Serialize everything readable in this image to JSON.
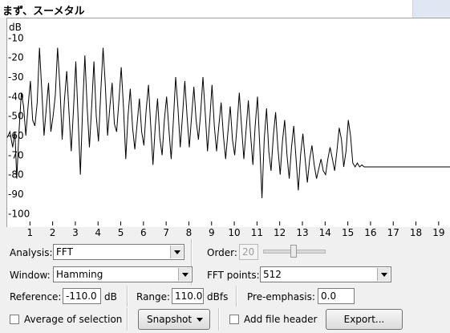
{
  "title": "まず、スーメタル",
  "chart_data": {
    "type": "line",
    "ylabel": "dB",
    "y_ticks": [
      "-10",
      "-20",
      "-30",
      "-40",
      "-50",
      "-60",
      "-70",
      "-80",
      "-90",
      "-100"
    ],
    "x_ticks": [
      "1",
      "2",
      "3",
      "4",
      "5",
      "6",
      "7",
      "8",
      "9",
      "10",
      "11",
      "12",
      "13",
      "14",
      "15",
      "16",
      "17",
      "18",
      "19"
    ],
    "xlim": [
      0,
      19.5
    ],
    "ylim": [
      -106,
      0
    ],
    "series": [
      {
        "points": [
          [
            0.0,
            -61
          ],
          [
            0.12,
            -58
          ],
          [
            0.24,
            -66
          ],
          [
            0.34,
            -58
          ],
          [
            0.42,
            -82
          ],
          [
            0.52,
            -58
          ],
          [
            0.62,
            -38
          ],
          [
            0.72,
            -45
          ],
          [
            0.82,
            -60
          ],
          [
            0.92,
            -45
          ],
          [
            1.02,
            -32
          ],
          [
            1.12,
            -52
          ],
          [
            1.22,
            -55
          ],
          [
            1.32,
            -43
          ],
          [
            1.42,
            -15
          ],
          [
            1.52,
            -36
          ],
          [
            1.62,
            -60
          ],
          [
            1.72,
            -46
          ],
          [
            1.82,
            -33
          ],
          [
            1.92,
            -58
          ],
          [
            2.02,
            -50
          ],
          [
            2.12,
            -39
          ],
          [
            2.22,
            -15
          ],
          [
            2.32,
            -35
          ],
          [
            2.42,
            -62
          ],
          [
            2.52,
            -42
          ],
          [
            2.62,
            -27
          ],
          [
            2.72,
            -48
          ],
          [
            2.82,
            -68
          ],
          [
            2.92,
            -46
          ],
          [
            3.02,
            -22
          ],
          [
            3.12,
            -50
          ],
          [
            3.22,
            -80
          ],
          [
            3.32,
            -46
          ],
          [
            3.42,
            -19
          ],
          [
            3.52,
            -45
          ],
          [
            3.62,
            -66
          ],
          [
            3.72,
            -45
          ],
          [
            3.82,
            -22
          ],
          [
            3.92,
            -50
          ],
          [
            4.02,
            -63
          ],
          [
            4.12,
            -38
          ],
          [
            4.22,
            -15
          ],
          [
            4.32,
            -34
          ],
          [
            4.42,
            -60
          ],
          [
            4.52,
            -45
          ],
          [
            4.62,
            -33
          ],
          [
            4.72,
            -54
          ],
          [
            4.82,
            -58
          ],
          [
            4.92,
            -42
          ],
          [
            5.02,
            -25
          ],
          [
            5.12,
            -45
          ],
          [
            5.22,
            -72
          ],
          [
            5.32,
            -50
          ],
          [
            5.42,
            -36
          ],
          [
            5.52,
            -56
          ],
          [
            5.62,
            -67
          ],
          [
            5.72,
            -54
          ],
          [
            5.82,
            -41
          ],
          [
            5.92,
            -58
          ],
          [
            6.02,
            -65
          ],
          [
            6.12,
            -47
          ],
          [
            6.22,
            -34
          ],
          [
            6.32,
            -55
          ],
          [
            6.42,
            -75
          ],
          [
            6.52,
            -55
          ],
          [
            6.62,
            -41
          ],
          [
            6.72,
            -61
          ],
          [
            6.82,
            -70
          ],
          [
            6.92,
            -52
          ],
          [
            7.02,
            -40
          ],
          [
            7.12,
            -57
          ],
          [
            7.22,
            -72
          ],
          [
            7.32,
            -52
          ],
          [
            7.42,
            -30
          ],
          [
            7.52,
            -46
          ],
          [
            7.62,
            -66
          ],
          [
            7.72,
            -50
          ],
          [
            7.82,
            -32
          ],
          [
            7.92,
            -50
          ],
          [
            8.02,
            -66
          ],
          [
            8.12,
            -50
          ],
          [
            8.22,
            -35
          ],
          [
            8.32,
            -52
          ],
          [
            8.42,
            -62
          ],
          [
            8.52,
            -48
          ],
          [
            8.62,
            -30
          ],
          [
            8.72,
            -48
          ],
          [
            8.82,
            -68
          ],
          [
            8.92,
            -52
          ],
          [
            9.02,
            -34
          ],
          [
            9.12,
            -55
          ],
          [
            9.22,
            -68
          ],
          [
            9.32,
            -55
          ],
          [
            9.42,
            -43
          ],
          [
            9.52,
            -60
          ],
          [
            9.62,
            -72
          ],
          [
            9.72,
            -58
          ],
          [
            9.82,
            -45
          ],
          [
            9.92,
            -62
          ],
          [
            10.02,
            -70
          ],
          [
            10.12,
            -55
          ],
          [
            10.22,
            -38
          ],
          [
            10.32,
            -55
          ],
          [
            10.42,
            -72
          ],
          [
            10.52,
            -57
          ],
          [
            10.62,
            -42
          ],
          [
            10.72,
            -60
          ],
          [
            10.82,
            -75
          ],
          [
            10.92,
            -55
          ],
          [
            11.02,
            -40
          ],
          [
            11.12,
            -65
          ],
          [
            11.22,
            -92
          ],
          [
            11.32,
            -62
          ],
          [
            11.42,
            -46
          ],
          [
            11.52,
            -68
          ],
          [
            11.62,
            -78
          ],
          [
            11.72,
            -60
          ],
          [
            11.82,
            -48
          ],
          [
            11.92,
            -66
          ],
          [
            12.02,
            -80
          ],
          [
            12.12,
            -63
          ],
          [
            12.22,
            -52
          ],
          [
            12.32,
            -70
          ],
          [
            12.42,
            -82
          ],
          [
            12.52,
            -66
          ],
          [
            12.62,
            -55
          ],
          [
            12.72,
            -72
          ],
          [
            12.82,
            -88
          ],
          [
            12.92,
            -70
          ],
          [
            13.02,
            -59
          ],
          [
            13.12,
            -72
          ],
          [
            13.22,
            -84
          ],
          [
            13.32,
            -72
          ],
          [
            13.42,
            -65
          ],
          [
            13.52,
            -75
          ],
          [
            13.62,
            -82
          ],
          [
            13.72,
            -77
          ],
          [
            13.82,
            -72
          ],
          [
            13.92,
            -78
          ],
          [
            14.02,
            -80
          ],
          [
            14.12,
            -72
          ],
          [
            14.22,
            -66
          ],
          [
            14.32,
            -72
          ],
          [
            14.42,
            -78
          ],
          [
            14.52,
            -68
          ],
          [
            14.62,
            -56
          ],
          [
            14.72,
            -62
          ],
          [
            14.82,
            -76
          ],
          [
            14.92,
            -68
          ],
          [
            15.02,
            -52
          ],
          [
            15.12,
            -60
          ],
          [
            15.22,
            -74
          ],
          [
            15.32,
            -76
          ],
          [
            15.42,
            -74
          ],
          [
            15.52,
            -76
          ],
          [
            15.62,
            -75
          ],
          [
            15.72,
            -76
          ],
          [
            15.82,
            -76
          ],
          [
            16.0,
            -76
          ],
          [
            17.0,
            -76
          ],
          [
            18.0,
            -76
          ],
          [
            19.0,
            -76
          ],
          [
            19.5,
            -76
          ]
        ]
      }
    ]
  },
  "controls": {
    "analysis_label": "Analysis:",
    "analysis_value": "FFT",
    "order_label": "Order:",
    "order_value": "20",
    "window_label": "Window:",
    "window_value": "Hamming",
    "fft_points_label": "FFT points:",
    "fft_points_value": "512",
    "reference_label": "Reference:",
    "reference_value": "-110.0",
    "reference_unit": "dB",
    "range_label": "Range:",
    "range_value": "110.0",
    "range_unit": "dBfs",
    "preemphasis_label": "Pre-emphasis:",
    "preemphasis_value": "0.0",
    "average_label": "Average of selection",
    "snapshot_label": "Snapshot",
    "add_header_label": "Add file header",
    "export_label": "Export..."
  }
}
